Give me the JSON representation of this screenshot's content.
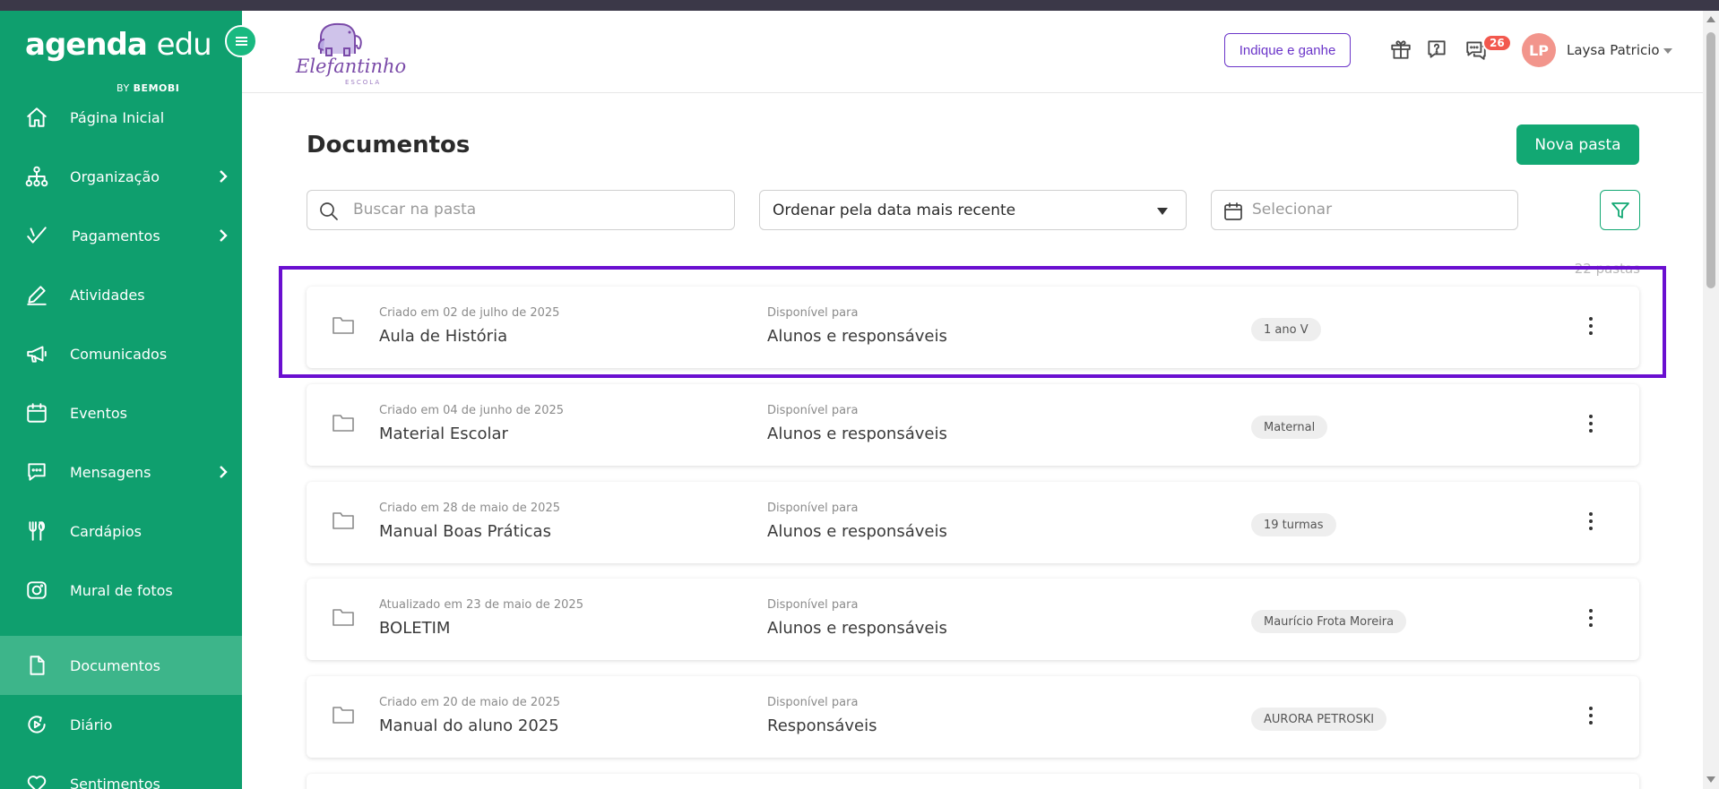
{
  "sidebar": {
    "brand": {
      "main_bold": "agenda",
      "main_light": "edu",
      "by": "BY",
      "company": "BEMOBI"
    },
    "items": [
      {
        "label": "Página Inicial",
        "icon": "home-icon",
        "has_chevron": false,
        "active": false
      },
      {
        "label": "Organização",
        "icon": "org-chart-icon",
        "has_chevron": true,
        "active": false
      },
      {
        "label": "Pagamentos",
        "icon": "payments-icon",
        "has_chevron": true,
        "active": false
      },
      {
        "label": "Atividades",
        "icon": "pencil-icon",
        "has_chevron": false,
        "active": false
      },
      {
        "label": "Comunicados",
        "icon": "megaphone-icon",
        "has_chevron": false,
        "active": false
      },
      {
        "label": "Eventos",
        "icon": "calendar-icon",
        "has_chevron": false,
        "active": false
      },
      {
        "label": "Mensagens",
        "icon": "chat-icon",
        "has_chevron": true,
        "active": false
      },
      {
        "label": "Cardápios",
        "icon": "cutlery-icon",
        "has_chevron": false,
        "active": false
      },
      {
        "label": "Mural de fotos",
        "icon": "camera-icon",
        "has_chevron": false,
        "active": false
      },
      {
        "label": "Documentos",
        "icon": "document-icon",
        "has_chevron": false,
        "active": true
      },
      {
        "label": "Diário",
        "icon": "diary-icon",
        "has_chevron": false,
        "active": false
      },
      {
        "label": "Sentimentos",
        "icon": "heart-icon",
        "has_chevron": false,
        "active": false
      }
    ]
  },
  "header": {
    "school_logo_text": "Elefantinho",
    "school_logo_sub": "ESCOLA",
    "refer_button": "Indique e ganhe",
    "notifications_count": "26",
    "user": {
      "initials": "LP",
      "name": "Laysa Patricio"
    }
  },
  "main": {
    "title": "Documentos",
    "new_folder_button": "Nova pasta",
    "search": {
      "placeholder": "Buscar na pasta",
      "value": ""
    },
    "sort": {
      "value": "Ordenar pela data mais recente"
    },
    "date": {
      "placeholder": "Selecionar",
      "value": ""
    },
    "count": "22 pastas",
    "folders": [
      {
        "created": "Criado em 02 de julho de 2025",
        "name": "Aula de História",
        "available_label": "Disponível para",
        "available": "Alunos e responsáveis",
        "tag": "1 ano V"
      },
      {
        "created": "Criado em 04 de junho de 2025",
        "name": "Material Escolar",
        "available_label": "Disponível para",
        "available": "Alunos e responsáveis",
        "tag": "Maternal"
      },
      {
        "created": "Criado em 28 de maio de 2025",
        "name": "Manual Boas Práticas",
        "available_label": "Disponível para",
        "available": "Alunos e responsáveis",
        "tag": "19 turmas"
      },
      {
        "created": "Atualizado em 23 de maio de 2025",
        "name": "BOLETIM",
        "available_label": "Disponível para",
        "available": "Alunos e responsáveis",
        "tag": "Maurício Frota Moreira"
      },
      {
        "created": "Criado em 20 de maio de 2025",
        "name": "Manual do aluno 2025",
        "available_label": "Disponível para",
        "available": "Responsáveis",
        "tag": "AURORA PETROSKI"
      }
    ]
  },
  "colors": {
    "sidebar_bg": "#0f9f6e",
    "sidebar_active": "#3db58a",
    "primary_button": "#12a873",
    "refer_outline": "#6b35c9",
    "highlight_outline": "#6a0fd0",
    "badge": "#f2584e",
    "avatar": "#f2958c"
  }
}
